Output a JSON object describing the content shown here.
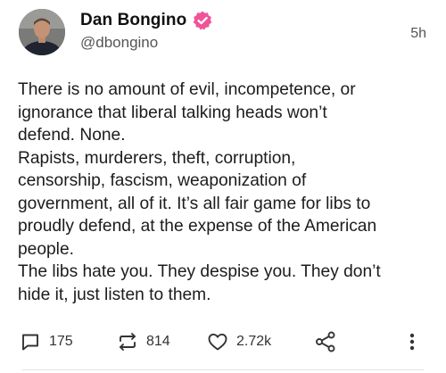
{
  "post": {
    "author": {
      "name": "Dan Bongino",
      "handle": "@dbongino",
      "verified": true,
      "verified_color": "#ee5499"
    },
    "timestamp": "5h",
    "text_lines": [
      "There is no amount of evil, incompetence, or",
      "ignorance that liberal talking heads won’t",
      "defend. None.",
      "Rapists, murderers, theft, corruption,",
      "censorship, fascism, weaponization of",
      "government, all of it. It’s all fair game for libs to",
      "proudly defend, at the expense of the American",
      "people.",
      "The libs hate you. They despise you. They don’t",
      "hide it, just listen to them."
    ],
    "actions": {
      "reply": {
        "icon": "reply-icon",
        "count": "175"
      },
      "repost": {
        "icon": "repost-icon",
        "count": "814"
      },
      "like": {
        "icon": "heart-icon",
        "count": "2.72k"
      },
      "share": {
        "icon": "share-icon"
      },
      "more": {
        "icon": "more-vertical-icon"
      }
    }
  }
}
